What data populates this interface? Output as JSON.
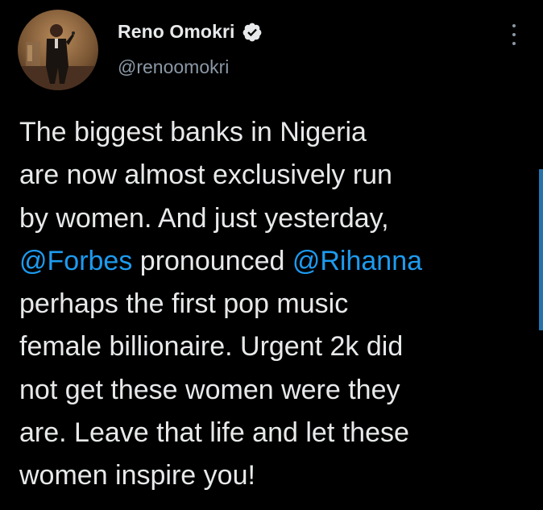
{
  "author": {
    "display_name": "Reno Omokri",
    "handle": "@renoomokri",
    "verified": true
  },
  "tweet": {
    "segments": [
      {
        "text": "The biggest banks in Nigeria\nare now almost exclusively run\nby women. And just yesterday,\n",
        "type": "text"
      },
      {
        "text": "@Forbes",
        "type": "mention"
      },
      {
        "text": " pronounced ",
        "type": "text"
      },
      {
        "text": "@Rihanna",
        "type": "mention"
      },
      {
        "text": "\nperhaps the first pop music\nfemale billionaire. Urgent 2k did\nnot get these women were they\nare. Leave that life and let these\nwomen inspire you!",
        "type": "text"
      }
    ]
  },
  "icons": {
    "verified": "verified-badge-icon",
    "more": "more-options-icon"
  },
  "colors": {
    "background": "#000000",
    "text": "#e7e9ea",
    "secondary_text": "#8b98a5",
    "mention": "#1d9bf0"
  }
}
